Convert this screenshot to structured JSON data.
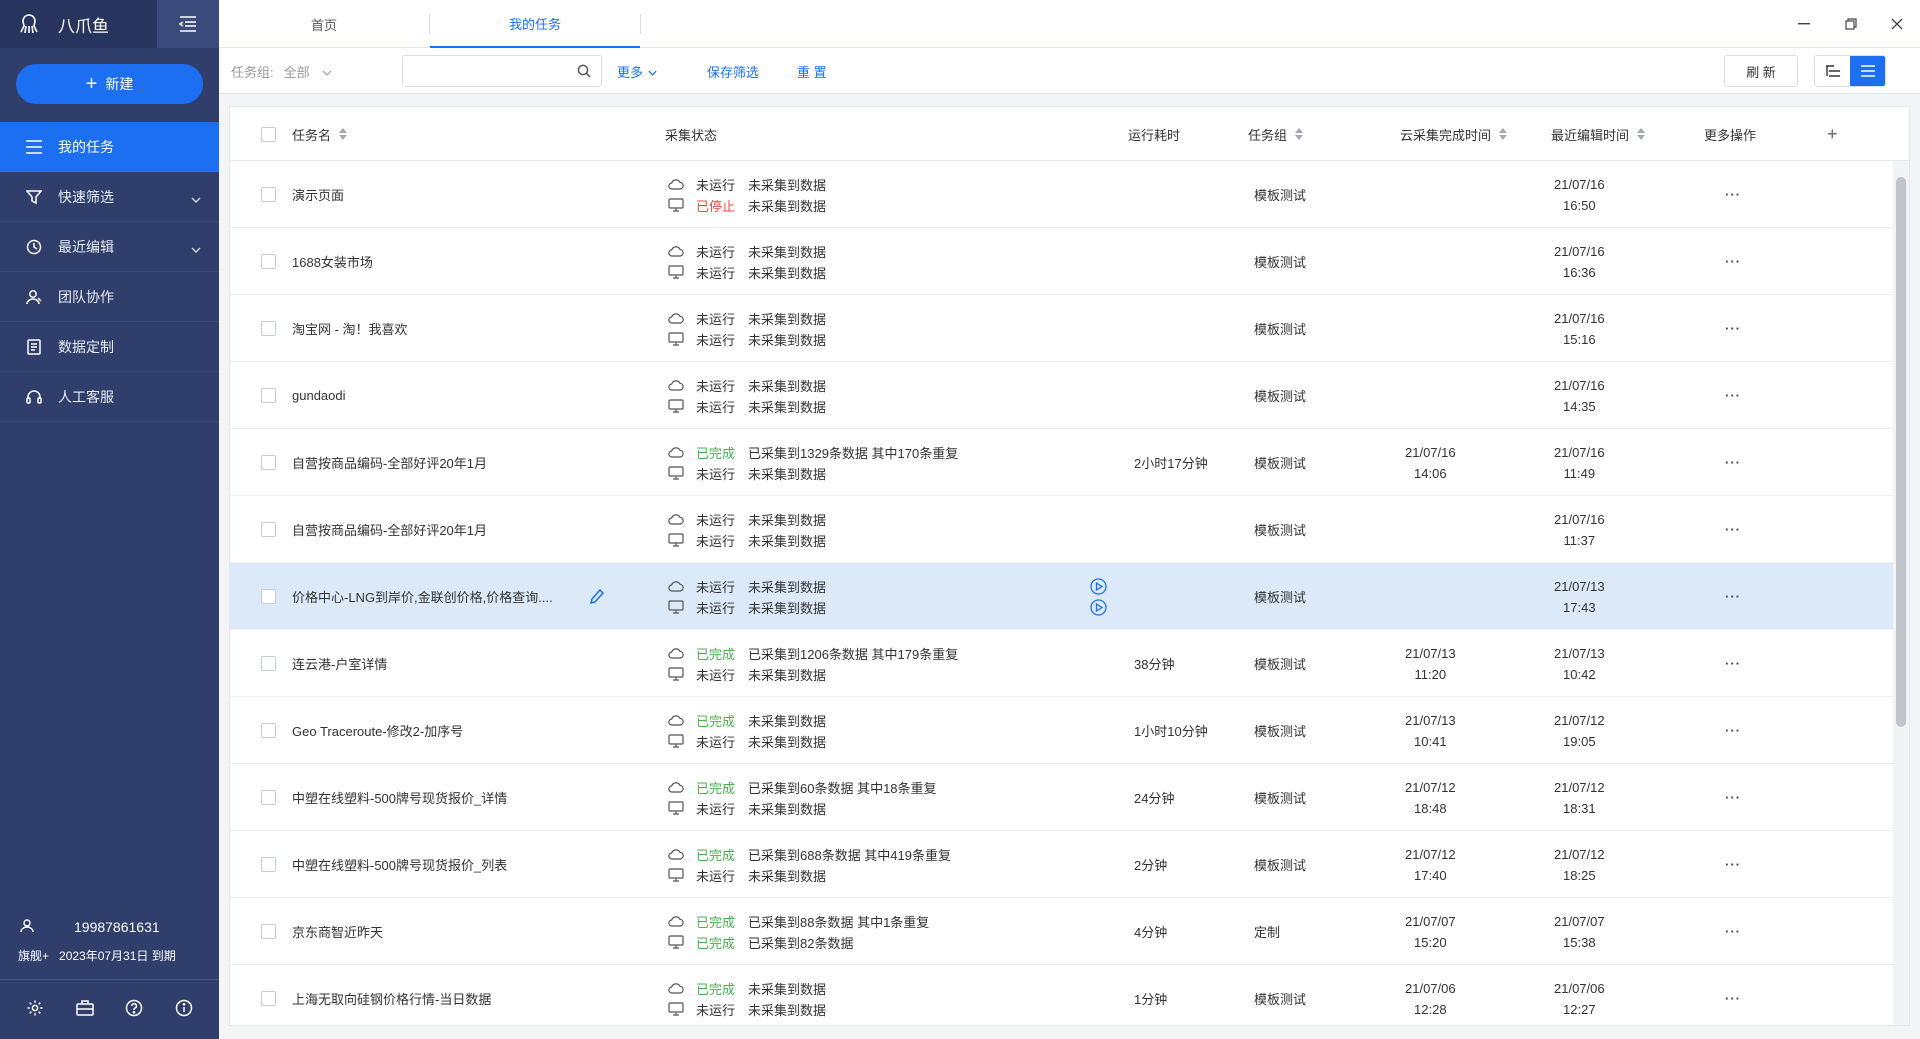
{
  "app": {
    "name": "八爪鱼"
  },
  "sidebar": {
    "new_label": "新建",
    "items": [
      {
        "label": "我的任务",
        "icon": "list-icon",
        "active": true
      },
      {
        "label": "快速筛选",
        "icon": "filter-icon",
        "has_chevron": true
      },
      {
        "label": "最近编辑",
        "icon": "clock-icon",
        "has_chevron": true
      },
      {
        "label": "团队协作",
        "icon": "team-icon"
      },
      {
        "label": "数据定制",
        "icon": "document-icon"
      },
      {
        "label": "人工客服",
        "icon": "headset-icon"
      }
    ],
    "user": {
      "phone": "19987861631",
      "plan": "旗舰+",
      "expiry": "2023年07月31日 到期"
    }
  },
  "tabs": [
    {
      "label": "首页",
      "active": false
    },
    {
      "label": "我的任务",
      "active": true
    }
  ],
  "filter": {
    "group_label": "任务组:",
    "group_value": "全部",
    "search_placeholder": "",
    "more": "更多",
    "save": "保存筛选",
    "reset": "重 置",
    "refresh": "刷 新"
  },
  "table": {
    "headers": {
      "name": "任务名",
      "status": "采集状态",
      "runtime": "运行耗时",
      "group": "任务组",
      "cloud_done": "云采集完成时间",
      "last_edit": "最近编辑时间",
      "more": "更多操作",
      "add": "+"
    },
    "rows": [
      {
        "name": "演示页面",
        "cloud_state": "未运行",
        "cloud_state_color": "normal",
        "cloud_text": "未采集到数据",
        "local_state": "已停止",
        "local_state_color": "red",
        "local_text": "未采集到数据",
        "runtime": "",
        "group": "模板测试",
        "cloud_date": "",
        "cloud_time": "",
        "edit_date": "21/07/16",
        "edit_time": "16:50"
      },
      {
        "name": "1688女装市场",
        "cloud_state": "未运行",
        "cloud_state_color": "normal",
        "cloud_text": "未采集到数据",
        "local_state": "未运行",
        "local_state_color": "normal",
        "local_text": "未采集到数据",
        "runtime": "",
        "group": "模板测试",
        "cloud_date": "",
        "cloud_time": "",
        "edit_date": "21/07/16",
        "edit_time": "16:36"
      },
      {
        "name": "淘宝网 - 淘！我喜欢",
        "cloud_state": "未运行",
        "cloud_state_color": "normal",
        "cloud_text": "未采集到数据",
        "local_state": "未运行",
        "local_state_color": "normal",
        "local_text": "未采集到数据",
        "runtime": "",
        "group": "模板测试",
        "cloud_date": "",
        "cloud_time": "",
        "edit_date": "21/07/16",
        "edit_time": "15:16"
      },
      {
        "name": "gundaodi",
        "cloud_state": "未运行",
        "cloud_state_color": "normal",
        "cloud_text": "未采集到数据",
        "local_state": "未运行",
        "local_state_color": "normal",
        "local_text": "未采集到数据",
        "runtime": "",
        "group": "模板测试",
        "cloud_date": "",
        "cloud_time": "",
        "edit_date": "21/07/16",
        "edit_time": "14:35"
      },
      {
        "name": "自营按商品编码-全部好评20年1月",
        "cloud_state": "已完成",
        "cloud_state_color": "green",
        "cloud_text": "已采集到1329条数据 其中170条重复",
        "local_state": "未运行",
        "local_state_color": "normal",
        "local_text": "未采集到数据",
        "runtime": "2小时17分钟",
        "group": "模板测试",
        "cloud_date": "21/07/16",
        "cloud_time": "14:06",
        "edit_date": "21/07/16",
        "edit_time": "11:49"
      },
      {
        "name": "自营按商品编码-全部好评20年1月",
        "cloud_state": "未运行",
        "cloud_state_color": "normal",
        "cloud_text": "未采集到数据",
        "local_state": "未运行",
        "local_state_color": "normal",
        "local_text": "未采集到数据",
        "runtime": "",
        "group": "模板测试",
        "cloud_date": "",
        "cloud_time": "",
        "edit_date": "21/07/16",
        "edit_time": "11:37"
      },
      {
        "name": "价格中心-LNG到岸价,金联创价格,价格查询....",
        "cloud_state": "未运行",
        "cloud_state_color": "normal",
        "cloud_text": "未采集到数据",
        "local_state": "未运行",
        "local_state_color": "normal",
        "local_text": "未采集到数据",
        "runtime": "",
        "group": "模板测试",
        "cloud_date": "",
        "cloud_time": "",
        "edit_date": "21/07/13",
        "edit_time": "17:43",
        "highlight": true
      },
      {
        "name": "连云港-户室详情",
        "cloud_state": "已完成",
        "cloud_state_color": "green",
        "cloud_text": "已采集到1206条数据 其中179条重复",
        "local_state": "未运行",
        "local_state_color": "normal",
        "local_text": "未采集到数据",
        "runtime": "38分钟",
        "group": "模板测试",
        "cloud_date": "21/07/13",
        "cloud_time": "11:20",
        "edit_date": "21/07/13",
        "edit_time": "10:42"
      },
      {
        "name": "Geo Traceroute-修改2-加序号",
        "cloud_state": "已完成",
        "cloud_state_color": "green",
        "cloud_text": "未采集到数据",
        "local_state": "未运行",
        "local_state_color": "normal",
        "local_text": "未采集到数据",
        "runtime": "1小时10分钟",
        "group": "模板测试",
        "cloud_date": "21/07/13",
        "cloud_time": "10:41",
        "edit_date": "21/07/12",
        "edit_time": "19:05"
      },
      {
        "name": "中塑在线塑料-500牌号现货报价_详情",
        "cloud_state": "已完成",
        "cloud_state_color": "green",
        "cloud_text": "已采集到60条数据 其中18条重复",
        "local_state": "未运行",
        "local_state_color": "normal",
        "local_text": "未采集到数据",
        "runtime": "24分钟",
        "group": "模板测试",
        "cloud_date": "21/07/12",
        "cloud_time": "18:48",
        "edit_date": "21/07/12",
        "edit_time": "18:31"
      },
      {
        "name": "中塑在线塑料-500牌号现货报价_列表",
        "cloud_state": "已完成",
        "cloud_state_color": "green",
        "cloud_text": "已采集到688条数据 其中419条重复",
        "local_state": "未运行",
        "local_state_color": "normal",
        "local_text": "未采集到数据",
        "runtime": "2分钟",
        "group": "模板测试",
        "cloud_date": "21/07/12",
        "cloud_time": "17:40",
        "edit_date": "21/07/12",
        "edit_time": "18:25"
      },
      {
        "name": "京东商智近昨天",
        "cloud_state": "已完成",
        "cloud_state_color": "green",
        "cloud_text": "已采集到88条数据 其中1条重复",
        "local_state": "已完成",
        "local_state_color": "green",
        "local_text": "已采集到82条数据",
        "runtime": "4分钟",
        "group": "定制",
        "cloud_date": "21/07/07",
        "cloud_time": "15:20",
        "edit_date": "21/07/07",
        "edit_time": "15:38"
      },
      {
        "name": "上海无取向硅钢价格行情-当日数据",
        "cloud_state": "已完成",
        "cloud_state_color": "green",
        "cloud_text": "未采集到数据",
        "local_state": "未运行",
        "local_state_color": "normal",
        "local_text": "未采集到数据",
        "runtime": "1分钟",
        "group": "模板测试",
        "cloud_date": "21/07/06",
        "cloud_time": "12:28",
        "edit_date": "21/07/06",
        "edit_time": "12:27"
      }
    ]
  },
  "colors": {
    "primary": "#1d6ff2",
    "sidebar_bg": "#2f3e6a",
    "success": "#4caf50",
    "danger": "#f04a3e",
    "row_highlight": "#dbe9f8"
  }
}
